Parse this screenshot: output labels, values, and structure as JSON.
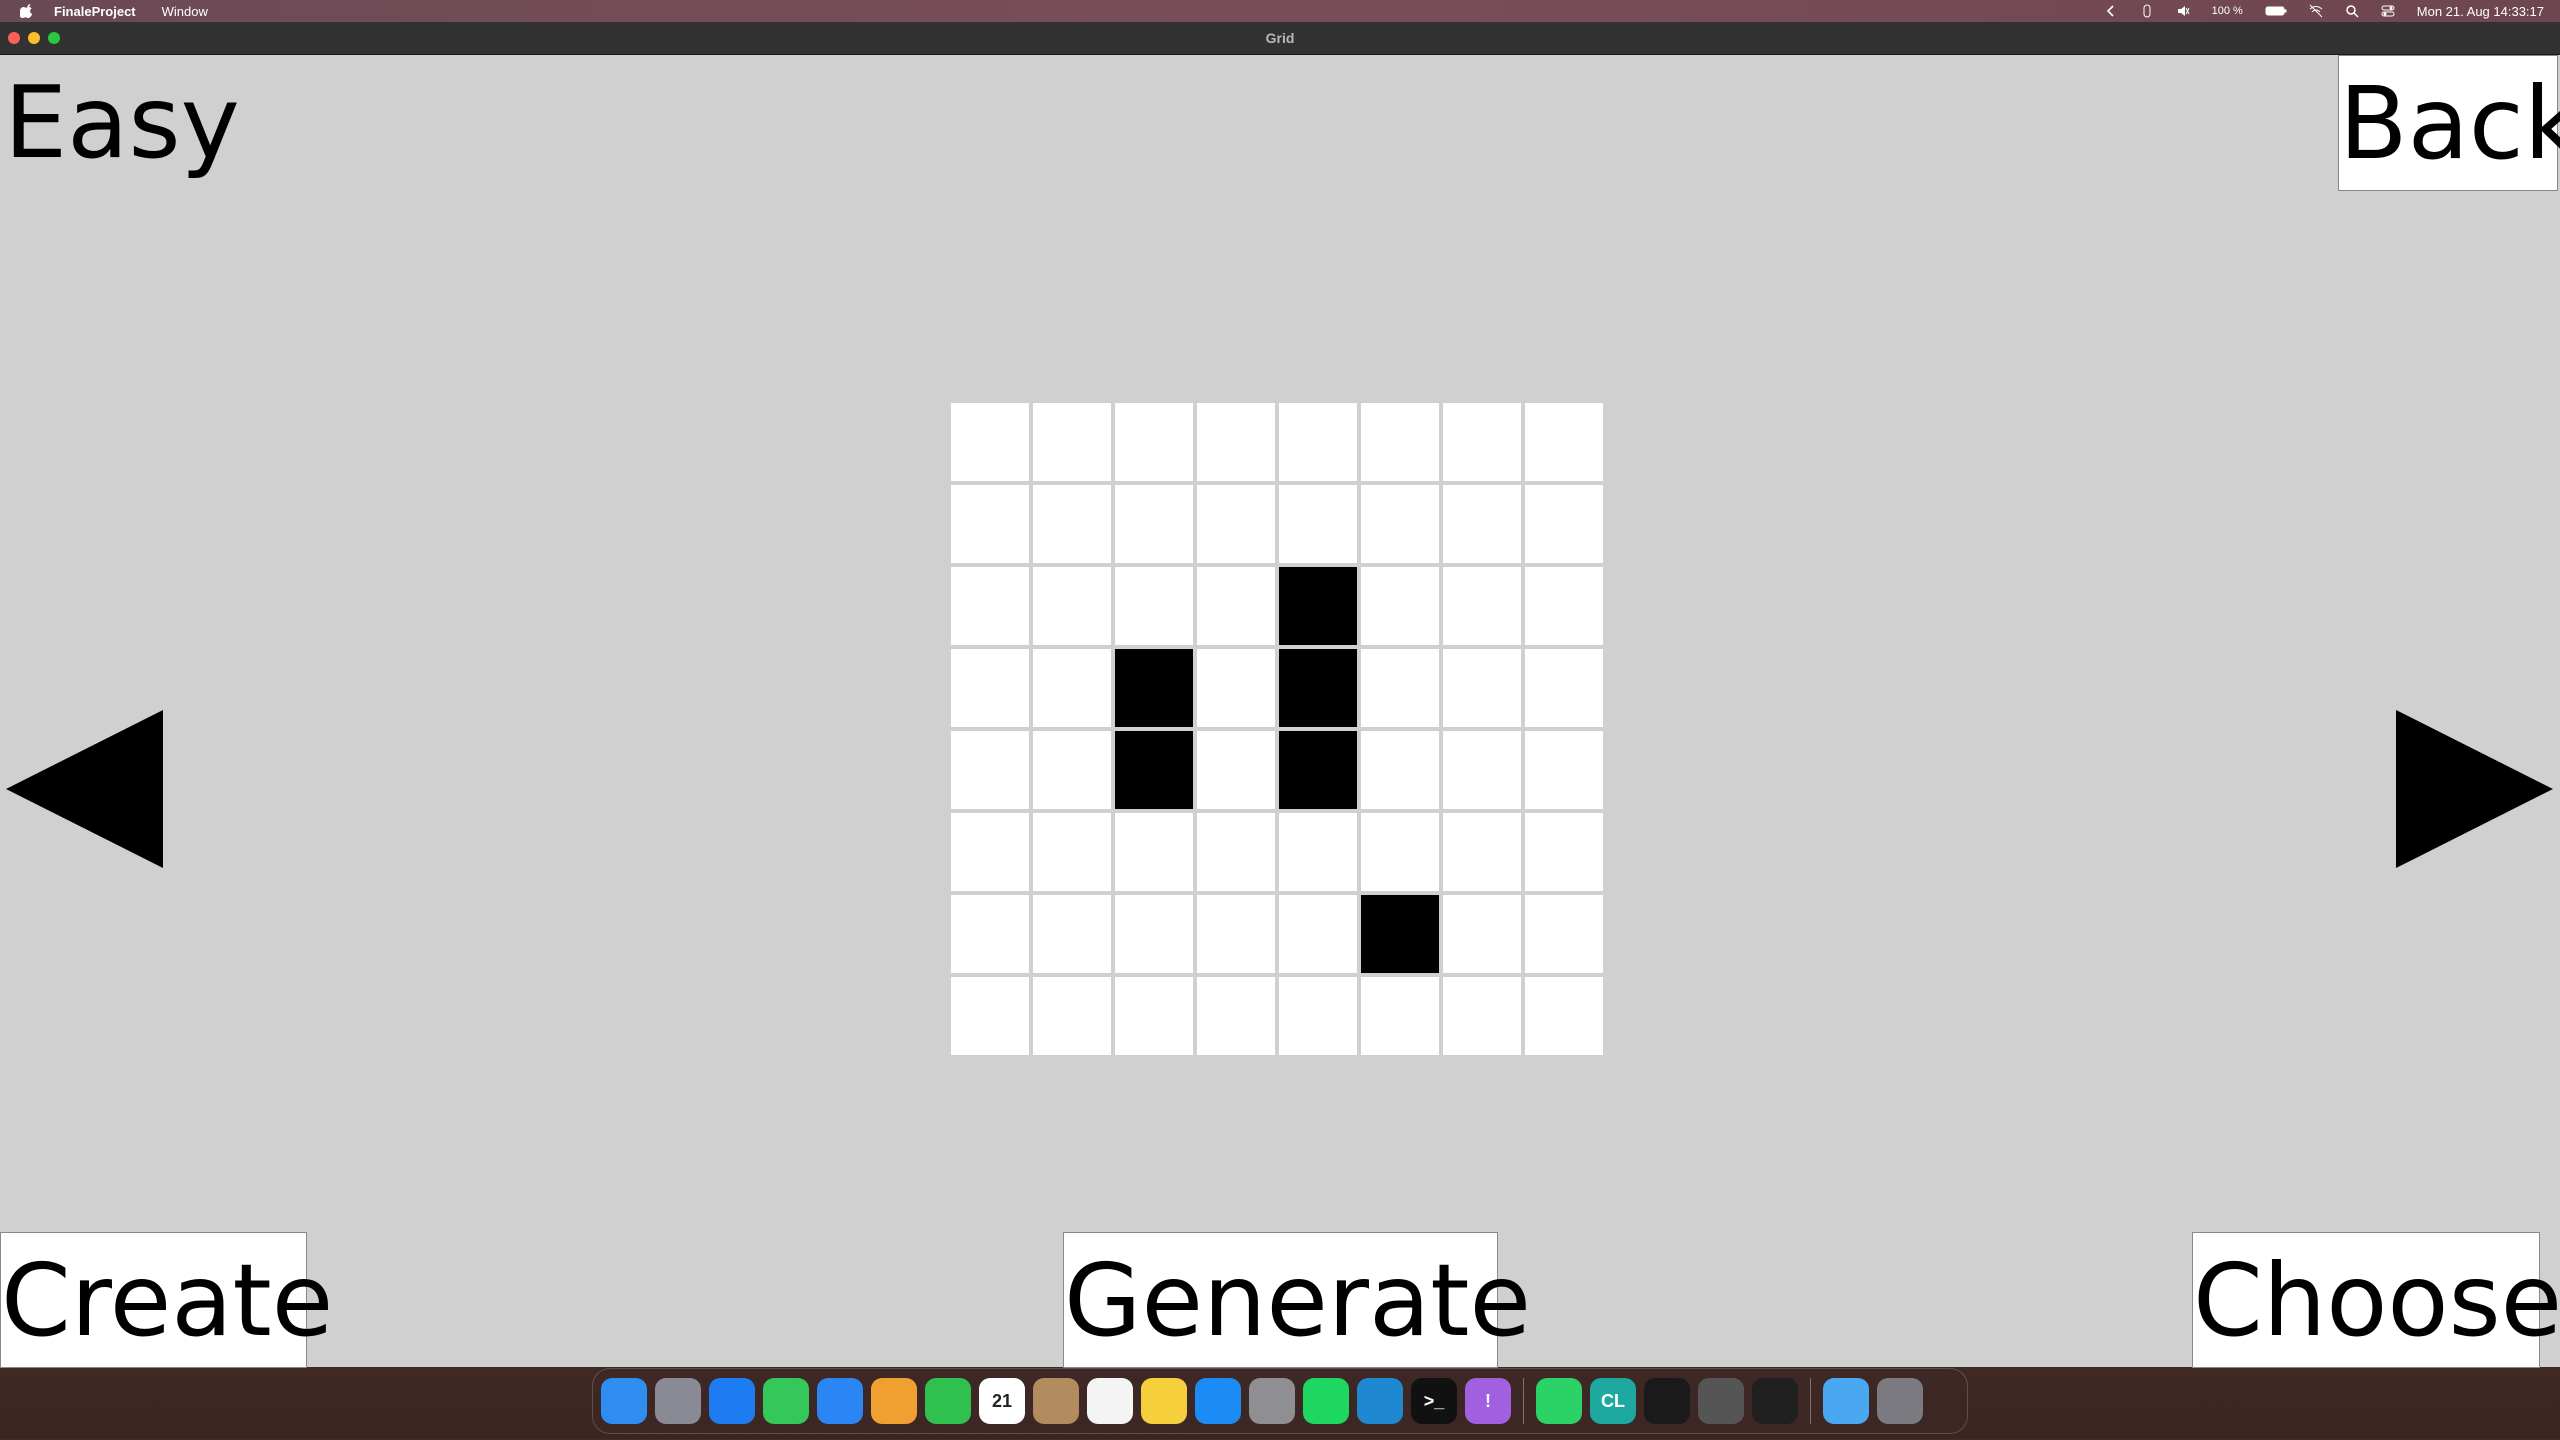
{
  "menubar": {
    "app_name": "FinaleProject",
    "items": [
      "Window"
    ],
    "battery": "100 %",
    "datetime": "Mon 21. Aug  14:33:17"
  },
  "window": {
    "title": "Grid"
  },
  "screen": {
    "difficulty": "Easy",
    "back_label": "Back",
    "create_label": "Create",
    "generate_label": "Generate",
    "choose_label": "Choose",
    "prev_icon": "triangle-left-icon",
    "next_icon": "triangle-right-icon"
  },
  "grid": {
    "rows": 8,
    "cols": 8,
    "filled": [
      [
        2,
        4
      ],
      [
        3,
        2
      ],
      [
        3,
        4
      ],
      [
        4,
        2
      ],
      [
        4,
        4
      ],
      [
        6,
        5
      ]
    ],
    "cell_color": "#ffffff",
    "filled_color": "#000000"
  },
  "dock": {
    "apps": [
      {
        "name": "finder",
        "color": "#2f8cf0",
        "glyph": ""
      },
      {
        "name": "launchpad",
        "color": "#8a8a95",
        "glyph": ""
      },
      {
        "name": "safari",
        "color": "#1e7cf2",
        "glyph": ""
      },
      {
        "name": "messages",
        "color": "#35c759",
        "glyph": ""
      },
      {
        "name": "mail",
        "color": "#2a86f5",
        "glyph": ""
      },
      {
        "name": "photos",
        "color": "#f0a030",
        "glyph": ""
      },
      {
        "name": "facetime",
        "color": "#30c050",
        "glyph": ""
      },
      {
        "name": "calendar",
        "color": "#ffffff",
        "glyph": "21"
      },
      {
        "name": "contacts",
        "color": "#b28b5e",
        "glyph": ""
      },
      {
        "name": "reminders",
        "color": "#f4f4f4",
        "glyph": ""
      },
      {
        "name": "notes",
        "color": "#f6cf3c",
        "glyph": ""
      },
      {
        "name": "app-store",
        "color": "#1c8bf5",
        "glyph": ""
      },
      {
        "name": "system-settings",
        "color": "#8e8e93",
        "glyph": ""
      },
      {
        "name": "spotify",
        "color": "#1ed760",
        "glyph": ""
      },
      {
        "name": "vscode",
        "color": "#1e89d0",
        "glyph": ""
      },
      {
        "name": "terminal",
        "color": "#111111",
        "glyph": ">_"
      },
      {
        "name": "feedback",
        "color": "#a060e0",
        "glyph": "!"
      },
      {
        "name": "whatsapp",
        "color": "#2bd366",
        "glyph": ""
      },
      {
        "name": "clion",
        "color": "#1ea9a0",
        "glyph": "CL"
      },
      {
        "name": "activity-monitor",
        "color": "#1a1a1a",
        "glyph": ""
      },
      {
        "name": "calculator",
        "color": "#555555",
        "glyph": ""
      },
      {
        "name": "console",
        "color": "#202020",
        "glyph": ""
      },
      {
        "name": "downloads-folder",
        "color": "#4aa8f0",
        "glyph": ""
      },
      {
        "name": "trash",
        "color": "#7a7a80",
        "glyph": ""
      }
    ]
  }
}
